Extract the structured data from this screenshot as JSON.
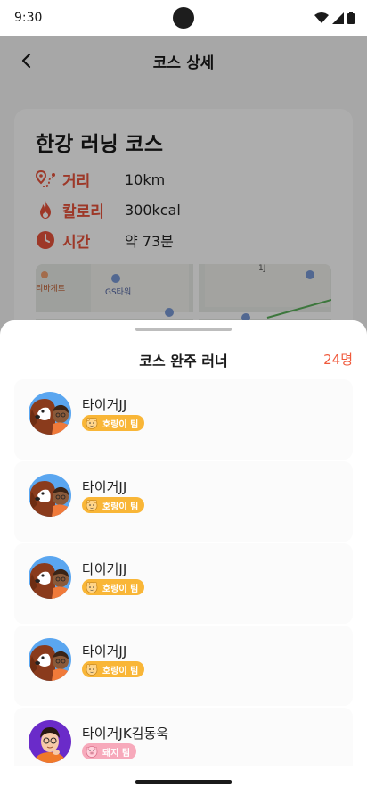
{
  "status_bar": {
    "time": "9:30"
  },
  "app_bar": {
    "title": "코스 상세"
  },
  "course": {
    "title": "한강 러닝 코스",
    "info": [
      {
        "icon": "route-pin-icon",
        "label": "거리",
        "value": "10km"
      },
      {
        "icon": "flame-icon",
        "label": "칼로리",
        "value": "300kcal"
      },
      {
        "icon": "clock-icon",
        "label": "시간",
        "value": "약 73분"
      }
    ],
    "map_labels": [
      "리바게트",
      "GS타워",
      "1J"
    ]
  },
  "sheet": {
    "title": "코스 완주 러너",
    "count": "24명",
    "runners": [
      {
        "name": "타이거JJ",
        "team": "호랑이 팀",
        "team_icon": "tiger-icon",
        "badge_color": "#f9b637",
        "avatar": "dog-and-boy-avatar"
      },
      {
        "name": "타이거JJ",
        "team": "호랑이 팀",
        "team_icon": "tiger-icon",
        "badge_color": "#f9b637",
        "avatar": "dog-and-boy-avatar"
      },
      {
        "name": "타이거JJ",
        "team": "호랑이 팀",
        "team_icon": "tiger-icon",
        "badge_color": "#f9b637",
        "avatar": "dog-and-boy-avatar"
      },
      {
        "name": "타이거JJ",
        "team": "호랑이 팀",
        "team_icon": "tiger-icon",
        "badge_color": "#f9b637",
        "avatar": "dog-and-boy-avatar"
      },
      {
        "name": "타이거JK김동욱",
        "team": "돼지 팀",
        "team_icon": "pig-icon",
        "badge_color": "#f7a9bb",
        "avatar": "thinking-man-avatar"
      }
    ]
  },
  "colors": {
    "accent": "#e8533c",
    "count": "#f05a3c"
  }
}
